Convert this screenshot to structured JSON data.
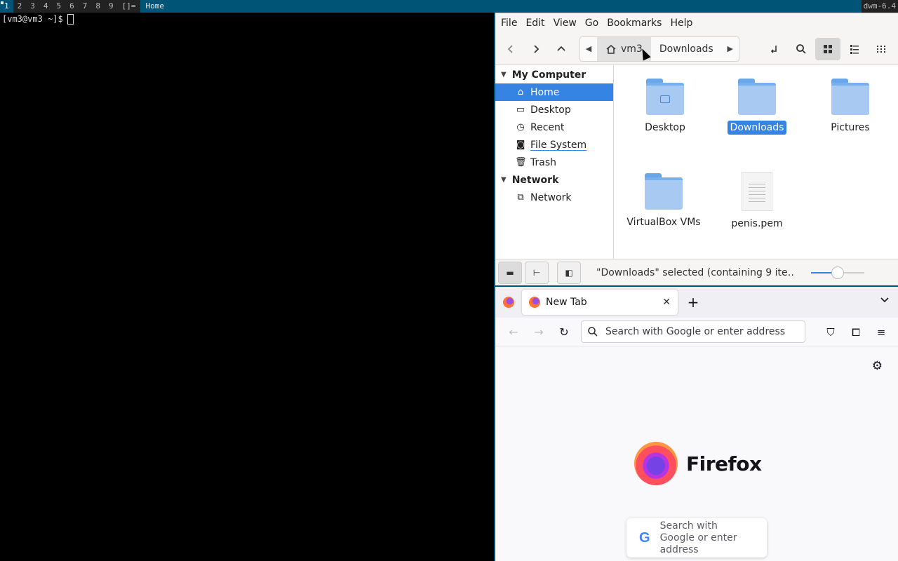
{
  "dwm": {
    "tags": [
      "1",
      "2",
      "3",
      "4",
      "5",
      "6",
      "7",
      "8",
      "9"
    ],
    "active_tag": "1",
    "layout_symbol": "[]=",
    "window_title": "Home",
    "status": "dwm-6.4"
  },
  "terminal": {
    "prompt": "[vm3@vm3 ~]$"
  },
  "file_manager": {
    "menu": [
      "File",
      "Edit",
      "View",
      "Go",
      "Bookmarks",
      "Help"
    ],
    "toolbar": {
      "back_icon": "chevron-left-icon",
      "forward_icon": "chevron-right-icon",
      "up_icon": "chevron-up-icon",
      "path": [
        "vm3",
        "Downloads"
      ],
      "current_path_item": "vm3"
    },
    "sidebar": {
      "sections": [
        {
          "title": "My Computer",
          "items": [
            {
              "label": "Home",
              "icon": "home-icon",
              "selected": true
            },
            {
              "label": "Desktop",
              "icon": "desktop-icon",
              "selected": false
            },
            {
              "label": "Recent",
              "icon": "clock-icon",
              "selected": false
            },
            {
              "label": "File System",
              "icon": "drive-icon",
              "selected": false
            },
            {
              "label": "Trash",
              "icon": "trash-icon",
              "selected": false
            }
          ]
        },
        {
          "title": "Network",
          "items": [
            {
              "label": "Network",
              "icon": "network-icon",
              "selected": false
            }
          ]
        }
      ]
    },
    "files": [
      {
        "name": "Desktop",
        "type": "folder",
        "emblem": true,
        "selected": false
      },
      {
        "name": "Downloads",
        "type": "folder",
        "emblem": false,
        "selected": true
      },
      {
        "name": "Pictures",
        "type": "folder",
        "emblem": false,
        "selected": false
      },
      {
        "name": "VirtualBox VMs",
        "type": "folder",
        "emblem": false,
        "selected": false
      },
      {
        "name": "penis.pem",
        "type": "document",
        "emblem": false,
        "selected": false
      }
    ],
    "status_text": "\"Downloads\" selected (containing 9 ite…",
    "zoom_level": 0.5
  },
  "firefox": {
    "tab_title": "New Tab",
    "urlbar_placeholder": "Search with Google or enter address",
    "brand_name": "Firefox",
    "search_box_text": "Search with Google or enter address",
    "google_glyph": "G",
    "colors": {
      "accent": "#3584e4",
      "dwm_blue": "#005577"
    }
  }
}
